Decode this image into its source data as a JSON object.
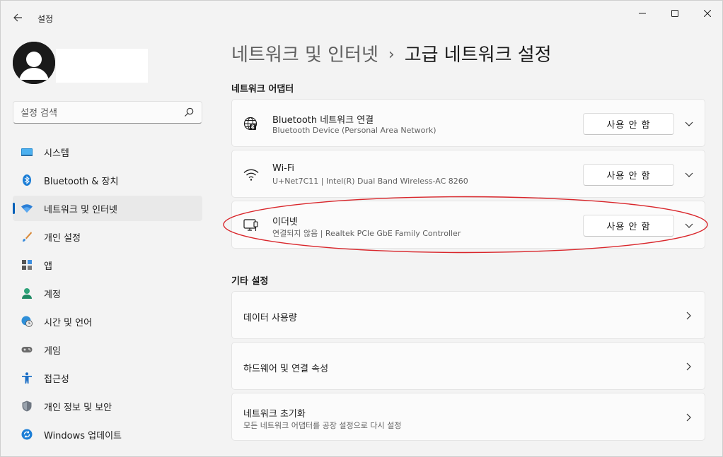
{
  "window": {
    "title": "설정"
  },
  "sidebar": {
    "search_placeholder": "설정 검색",
    "items": [
      {
        "label": "시스템",
        "icon": "system-icon"
      },
      {
        "label": "Bluetooth & 장치",
        "icon": "bluetooth-icon"
      },
      {
        "label": "네트워크 및 인터넷",
        "icon": "wifi-icon",
        "active": true
      },
      {
        "label": "개인 설정",
        "icon": "brush-icon"
      },
      {
        "label": "앱",
        "icon": "apps-icon"
      },
      {
        "label": "계정",
        "icon": "account-icon"
      },
      {
        "label": "시간 및 언어",
        "icon": "globe-clock-icon"
      },
      {
        "label": "게임",
        "icon": "gamepad-icon"
      },
      {
        "label": "접근성",
        "icon": "accessibility-icon"
      },
      {
        "label": "개인 정보 및 보안",
        "icon": "shield-icon"
      },
      {
        "label": "Windows 업데이트",
        "icon": "update-icon"
      }
    ]
  },
  "breadcrumb": {
    "parent": "네트워크 및 인터넷",
    "separator": "›",
    "current": "고급 네트워크 설정"
  },
  "adapters": {
    "heading": "네트워크 어댑터",
    "items": [
      {
        "title": "Bluetooth 네트워크 연결",
        "subtitle": "Bluetooth Device (Personal Area Network)",
        "button": "사용 안 함",
        "icon": "bluetooth-network-icon"
      },
      {
        "title": "Wi-Fi",
        "subtitle": "U+Net7C11 | Intel(R) Dual Band Wireless-AC 8260",
        "button": "사용 안 함",
        "icon": "wifi-icon"
      },
      {
        "title": "이더넷",
        "subtitle": "연결되지 않음 | Realtek PCIe GbE Family Controller",
        "button": "사용 안 함",
        "icon": "ethernet-icon"
      }
    ]
  },
  "other": {
    "heading": "기타 설정",
    "items": [
      {
        "title": "데이터 사용량"
      },
      {
        "title": "하드웨어 및 연결 속성"
      },
      {
        "title": "네트워크 초기화",
        "subtitle": "모든 네트워크 어댑터를 공장 설정으로 다시 설정"
      }
    ]
  },
  "colors": {
    "accent": "#005fb8",
    "annotation": "#d9262b"
  }
}
